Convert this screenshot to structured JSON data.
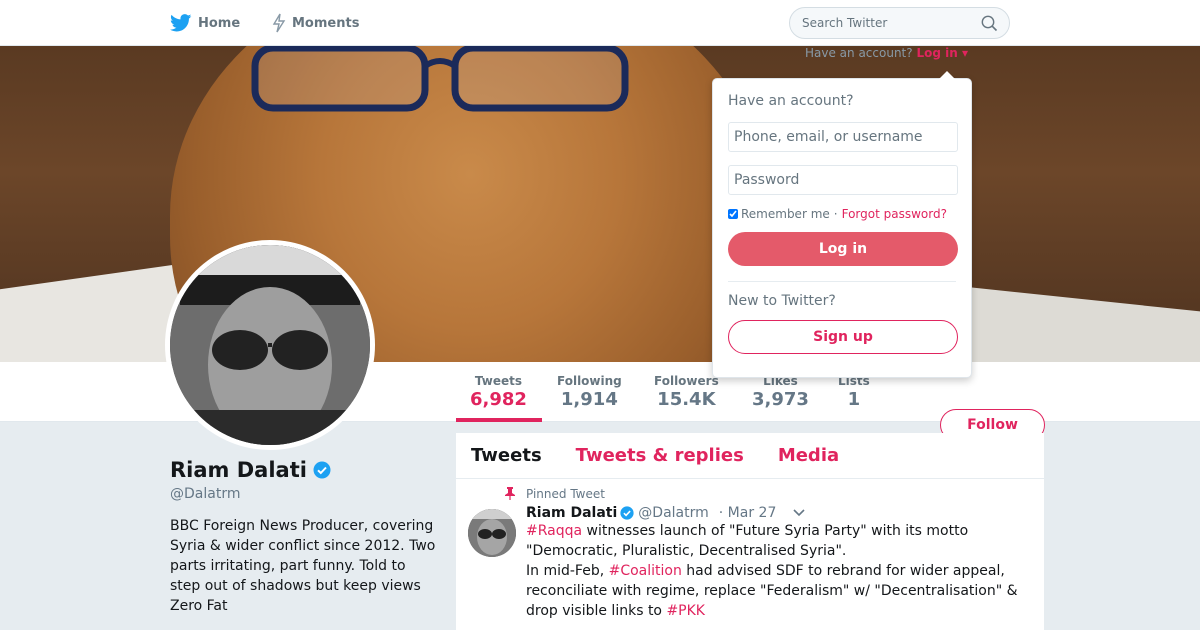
{
  "nav": {
    "home_label": "Home",
    "moments_label": "Moments",
    "search_placeholder": "Search Twitter"
  },
  "header": {
    "have_account_text": "Have an account?",
    "login_link": "Log in"
  },
  "login_dropdown": {
    "title": "Have an account?",
    "username_placeholder": "Phone, email, or username",
    "password_placeholder": "Password",
    "remember_me": "Remember me",
    "separator": "·",
    "forgot_password": "Forgot password?",
    "login_button": "Log in",
    "new_to_twitter": "New to Twitter?",
    "signup_button": "Sign up"
  },
  "stats": [
    {
      "label": "Tweets",
      "value": "6,982"
    },
    {
      "label": "Following",
      "value": "1,914"
    },
    {
      "label": "Followers",
      "value": "15.4K"
    },
    {
      "label": "Likes",
      "value": "3,973"
    },
    {
      "label": "Lists",
      "value": "1"
    }
  ],
  "follow_button": "Follow",
  "profile": {
    "name": "Riam Dalati",
    "handle": "@Dalatrm",
    "bio": "BBC Foreign News Producer, covering Syria & wider conflict since 2012. Two parts irritating, part funny. Told to step out of shadows but keep views Zero Fat"
  },
  "timeline": {
    "tabs": [
      "Tweets",
      "Tweets & replies",
      "Media"
    ],
    "pinned_label": "Pinned Tweet",
    "tweet": {
      "name": "Riam Dalati",
      "handle": "@Dalatrm",
      "date": "· Mar 27",
      "tag1": "#Raqqa",
      "text1": " witnesses launch of \"Future Syria Party\" with its motto \"Democratic, Pluralistic, Decentralised Syria\".",
      "text2": "In mid-Feb, ",
      "tag2": "#Coalition",
      "text3": " had advised SDF to rebrand for wider appeal, reconciliate with regime, replace \"Federalism\" w/ \"Decentralisation\" & drop visible links to ",
      "tag3": "#PKK"
    }
  },
  "colors": {
    "accent": "#e0245e",
    "login_button": "#e45a6a",
    "verified": "#1da1f2",
    "background": "#e6ecf0"
  }
}
